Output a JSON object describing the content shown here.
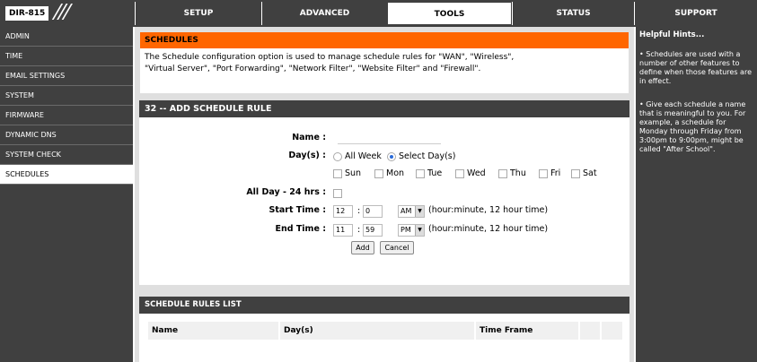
{
  "header": {
    "model": "DIR-815",
    "slashes": "///",
    "tabs": [
      {
        "label": "SETUP"
      },
      {
        "label": "ADVANCED"
      },
      {
        "label": "TOOLS"
      },
      {
        "label": "STATUS"
      },
      {
        "label": "SUPPORT"
      }
    ],
    "active_tab": "TOOLS"
  },
  "sidebar": {
    "items": [
      {
        "label": "ADMIN"
      },
      {
        "label": "TIME"
      },
      {
        "label": "EMAIL SETTINGS"
      },
      {
        "label": "SYSTEM"
      },
      {
        "label": "FIRMWARE"
      },
      {
        "label": "DYNAMIC DNS"
      },
      {
        "label": "SYSTEM CHECK"
      },
      {
        "label": "SCHEDULES"
      }
    ],
    "active_item": "SCHEDULES"
  },
  "schedules": {
    "title": "SCHEDULES",
    "desc_line1": "The Schedule configuration option is used to manage schedule rules for \"WAN\", \"Wireless\",",
    "desc_line2": "\"Virtual Server\", \"Port Forwarding\", \"Network Filter\", \"Website Filter\" and \"Firewall\"."
  },
  "add_rule": {
    "title": "32 -- ADD SCHEDULE RULE",
    "name_label": "Name :",
    "name_value": "",
    "days_label": "Day(s) :",
    "all_week_label": "All Week",
    "select_days_label": "Select Day(s)",
    "days": [
      {
        "label": "Sun"
      },
      {
        "label": "Mon"
      },
      {
        "label": "Tue"
      },
      {
        "label": "Wed"
      },
      {
        "label": "Thu"
      },
      {
        "label": "Fri"
      },
      {
        "label": "Sat"
      }
    ],
    "allday_label": "All Day - 24 hrs :",
    "start_label": "Start Time :",
    "start_hour": "12",
    "start_sep": ":",
    "start_minute": "0",
    "start_ampm": "AM",
    "end_label": "End Time :",
    "end_hour": "11",
    "end_sep": ":",
    "end_minute": "59",
    "end_ampm": "PM",
    "time_hint": "(hour:minute, 12 hour time)",
    "add_button": "Add",
    "cancel_button": "Cancel"
  },
  "rules_list": {
    "title": "SCHEDULE RULES LIST",
    "columns": [
      "Name",
      "Day(s)",
      "Time Frame"
    ]
  },
  "help": {
    "title": "Helpful Hints...",
    "para1": "• Schedules are used with a number of other features to define when those features are in effect.",
    "para2": "• Give each schedule a name that is meaningful to you. For example, a schedule for Monday through Friday from 3:00pm to 9:00pm, might be called \"After School\"."
  },
  "colors": {
    "dark_bar": "#404040",
    "orange_header": "#ff6600",
    "content_bg": "#dfdfdf"
  }
}
